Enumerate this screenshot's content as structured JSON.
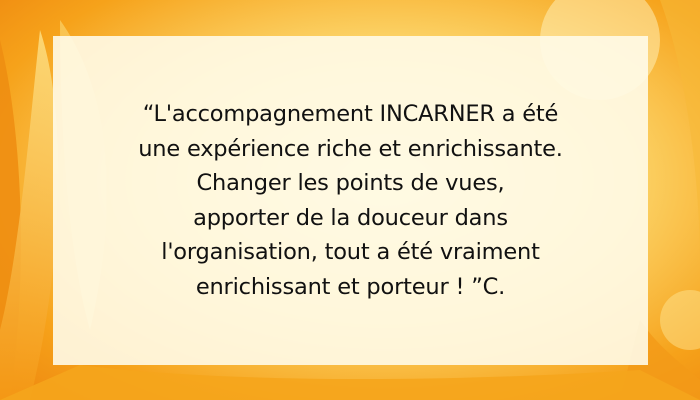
{
  "quote": {
    "lines": [
      "“L'accompagnement INCARNER a été",
      "une expérience riche et enrichissante.",
      "Changer les points de vues,",
      "apporter de la douceur dans",
      "l'organisation, tout a été vraiment",
      "enrichissant et porteur ! ”C."
    ]
  },
  "colors": {
    "background_orange": "#f6a21a",
    "background_light": "#fde9a0",
    "card_background": "#fffbe8",
    "text": "#111111"
  }
}
